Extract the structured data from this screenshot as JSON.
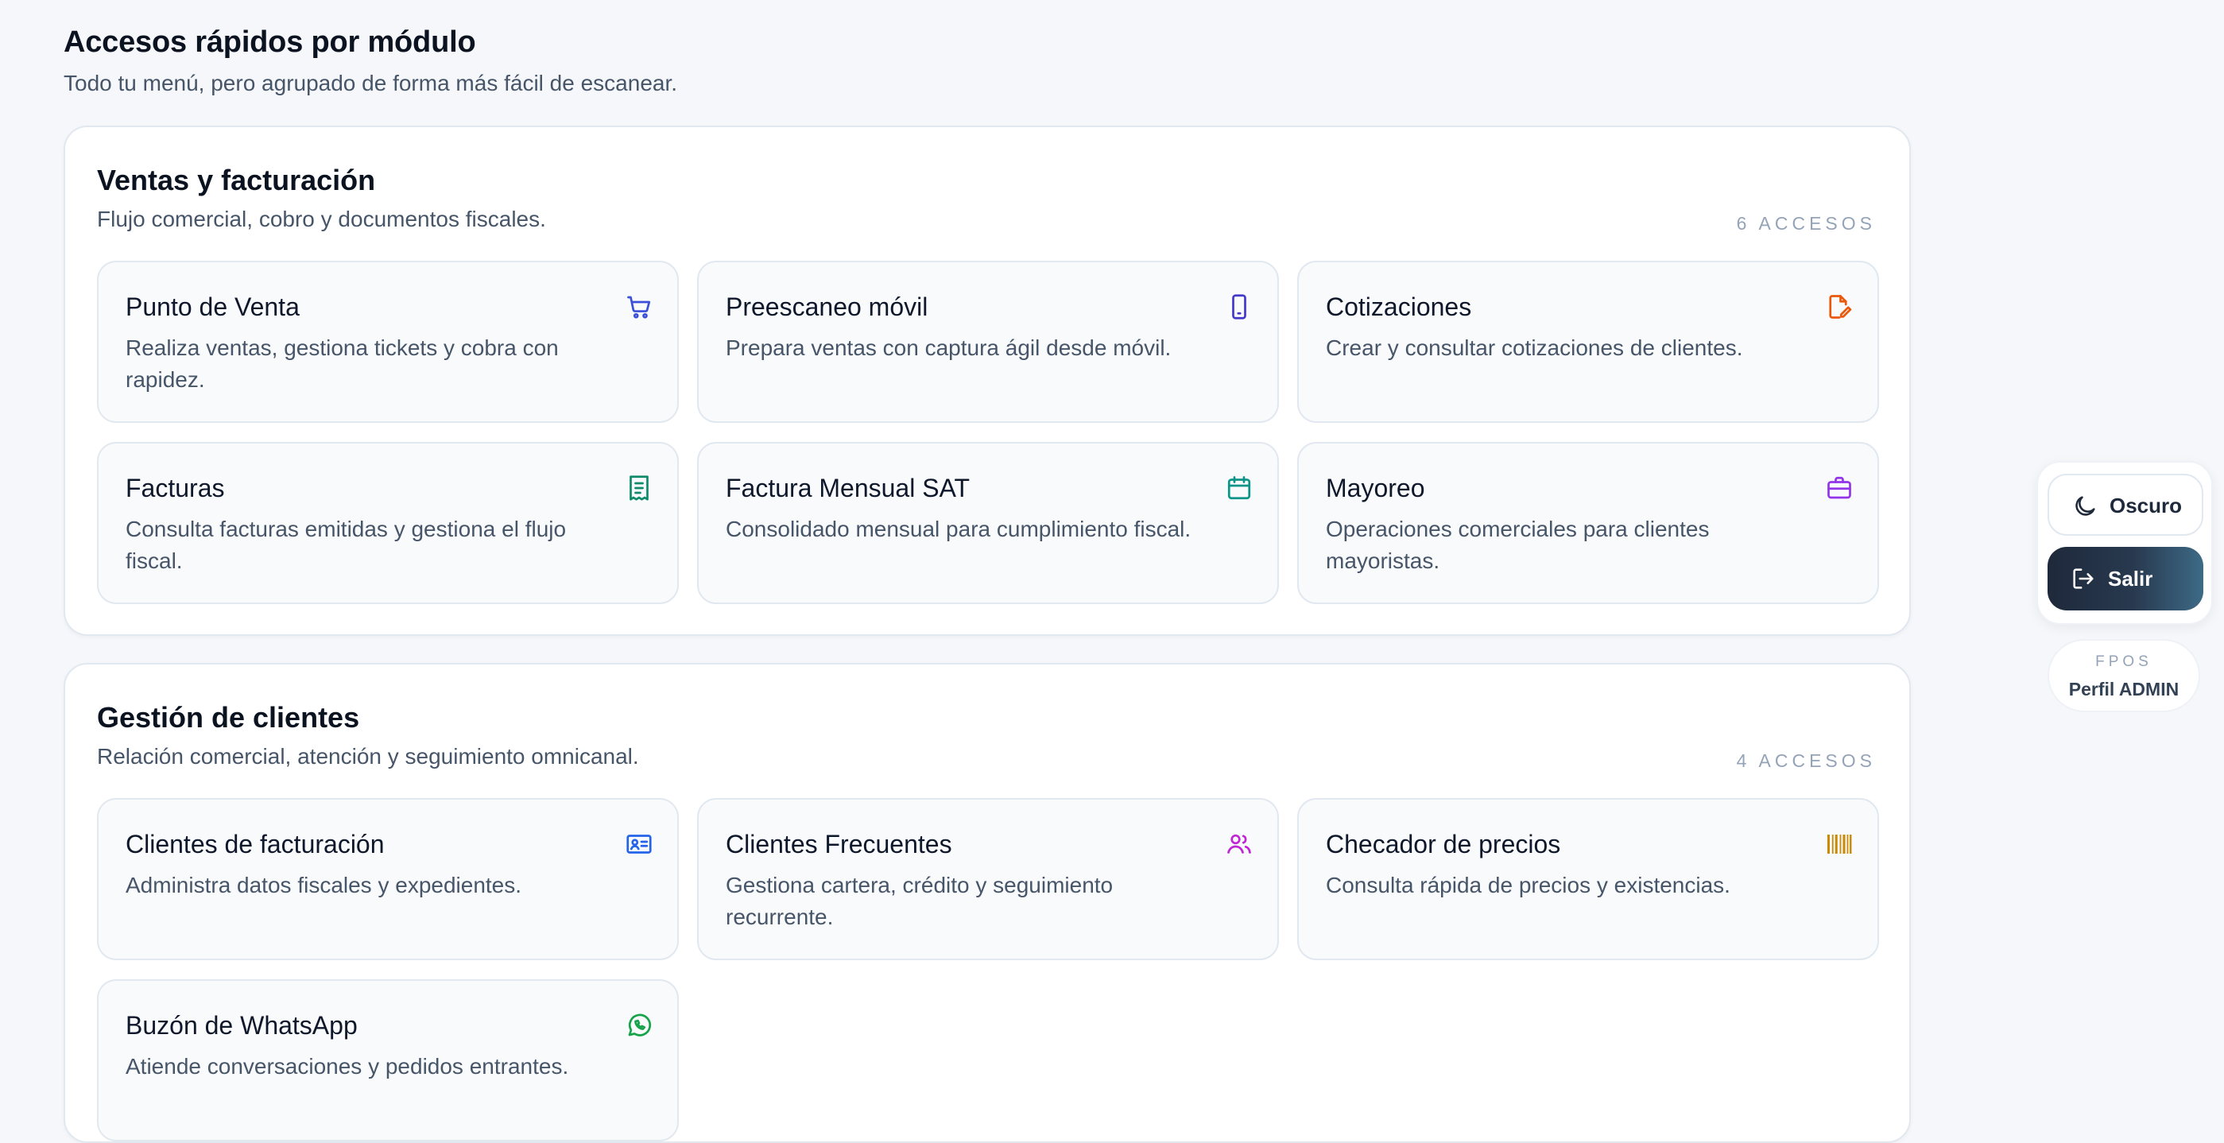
{
  "header": {
    "title": "Accesos rápidos por módulo",
    "subtitle": "Todo tu menú, pero agrupado de forma más fácil de escanear."
  },
  "sections": [
    {
      "title": "Ventas y facturación",
      "subtitle": "Flujo comercial, cobro y documentos fiscales.",
      "count": "6 ACCESOS",
      "cards": [
        {
          "title": "Punto de Venta",
          "desc": "Realiza ventas, gestiona tickets y cobra con rapidez.",
          "icon": "cart-icon",
          "color": "#3b4fd8"
        },
        {
          "title": "Preescaneo móvil",
          "desc": "Prepara ventas con captura ágil desde móvil.",
          "icon": "smartphone-icon",
          "color": "#4338ca"
        },
        {
          "title": "Cotizaciones",
          "desc": "Crear y consultar cotizaciones de clientes.",
          "icon": "file-edit-icon",
          "color": "#ea580c"
        },
        {
          "title": "Facturas",
          "desc": "Consulta facturas emitidas y gestiona el flujo fiscal.",
          "icon": "receipt-icon",
          "color": "#0f8a6a"
        },
        {
          "title": "Factura Mensual SAT",
          "desc": "Consolidado mensual para cumplimiento fiscal.",
          "icon": "calendar-icon",
          "color": "#0d9488"
        },
        {
          "title": "Mayoreo",
          "desc": "Operaciones comerciales para clientes mayoristas.",
          "icon": "briefcase-icon",
          "color": "#9333ea"
        }
      ]
    },
    {
      "title": "Gestión de clientes",
      "subtitle": "Relación comercial, atención y seguimiento omnicanal.",
      "count": "4 ACCESOS",
      "cards": [
        {
          "title": "Clientes de facturación",
          "desc": "Administra datos fiscales y expedientes.",
          "icon": "id-card-icon",
          "color": "#2563eb"
        },
        {
          "title": "Clientes Frecuentes",
          "desc": "Gestiona cartera, crédito y seguimiento recurrente.",
          "icon": "users-icon",
          "color": "#c026d3"
        },
        {
          "title": "Checador de precios",
          "desc": "Consulta rápida de precios y existencias.",
          "icon": "barcode-icon",
          "color": "#ca8a04"
        },
        {
          "title": "Buzón de WhatsApp",
          "desc": "Atiende conversaciones y pedidos entrantes.",
          "icon": "whatsapp-icon",
          "color": "#16a34a"
        }
      ]
    }
  ],
  "side": {
    "theme_label": "Oscuro",
    "theme_icon": "moon-icon",
    "logout_label": "Salir",
    "logout_icon": "logout-icon",
    "app_name": "FPOS",
    "profile": "Perfil ADMIN"
  }
}
